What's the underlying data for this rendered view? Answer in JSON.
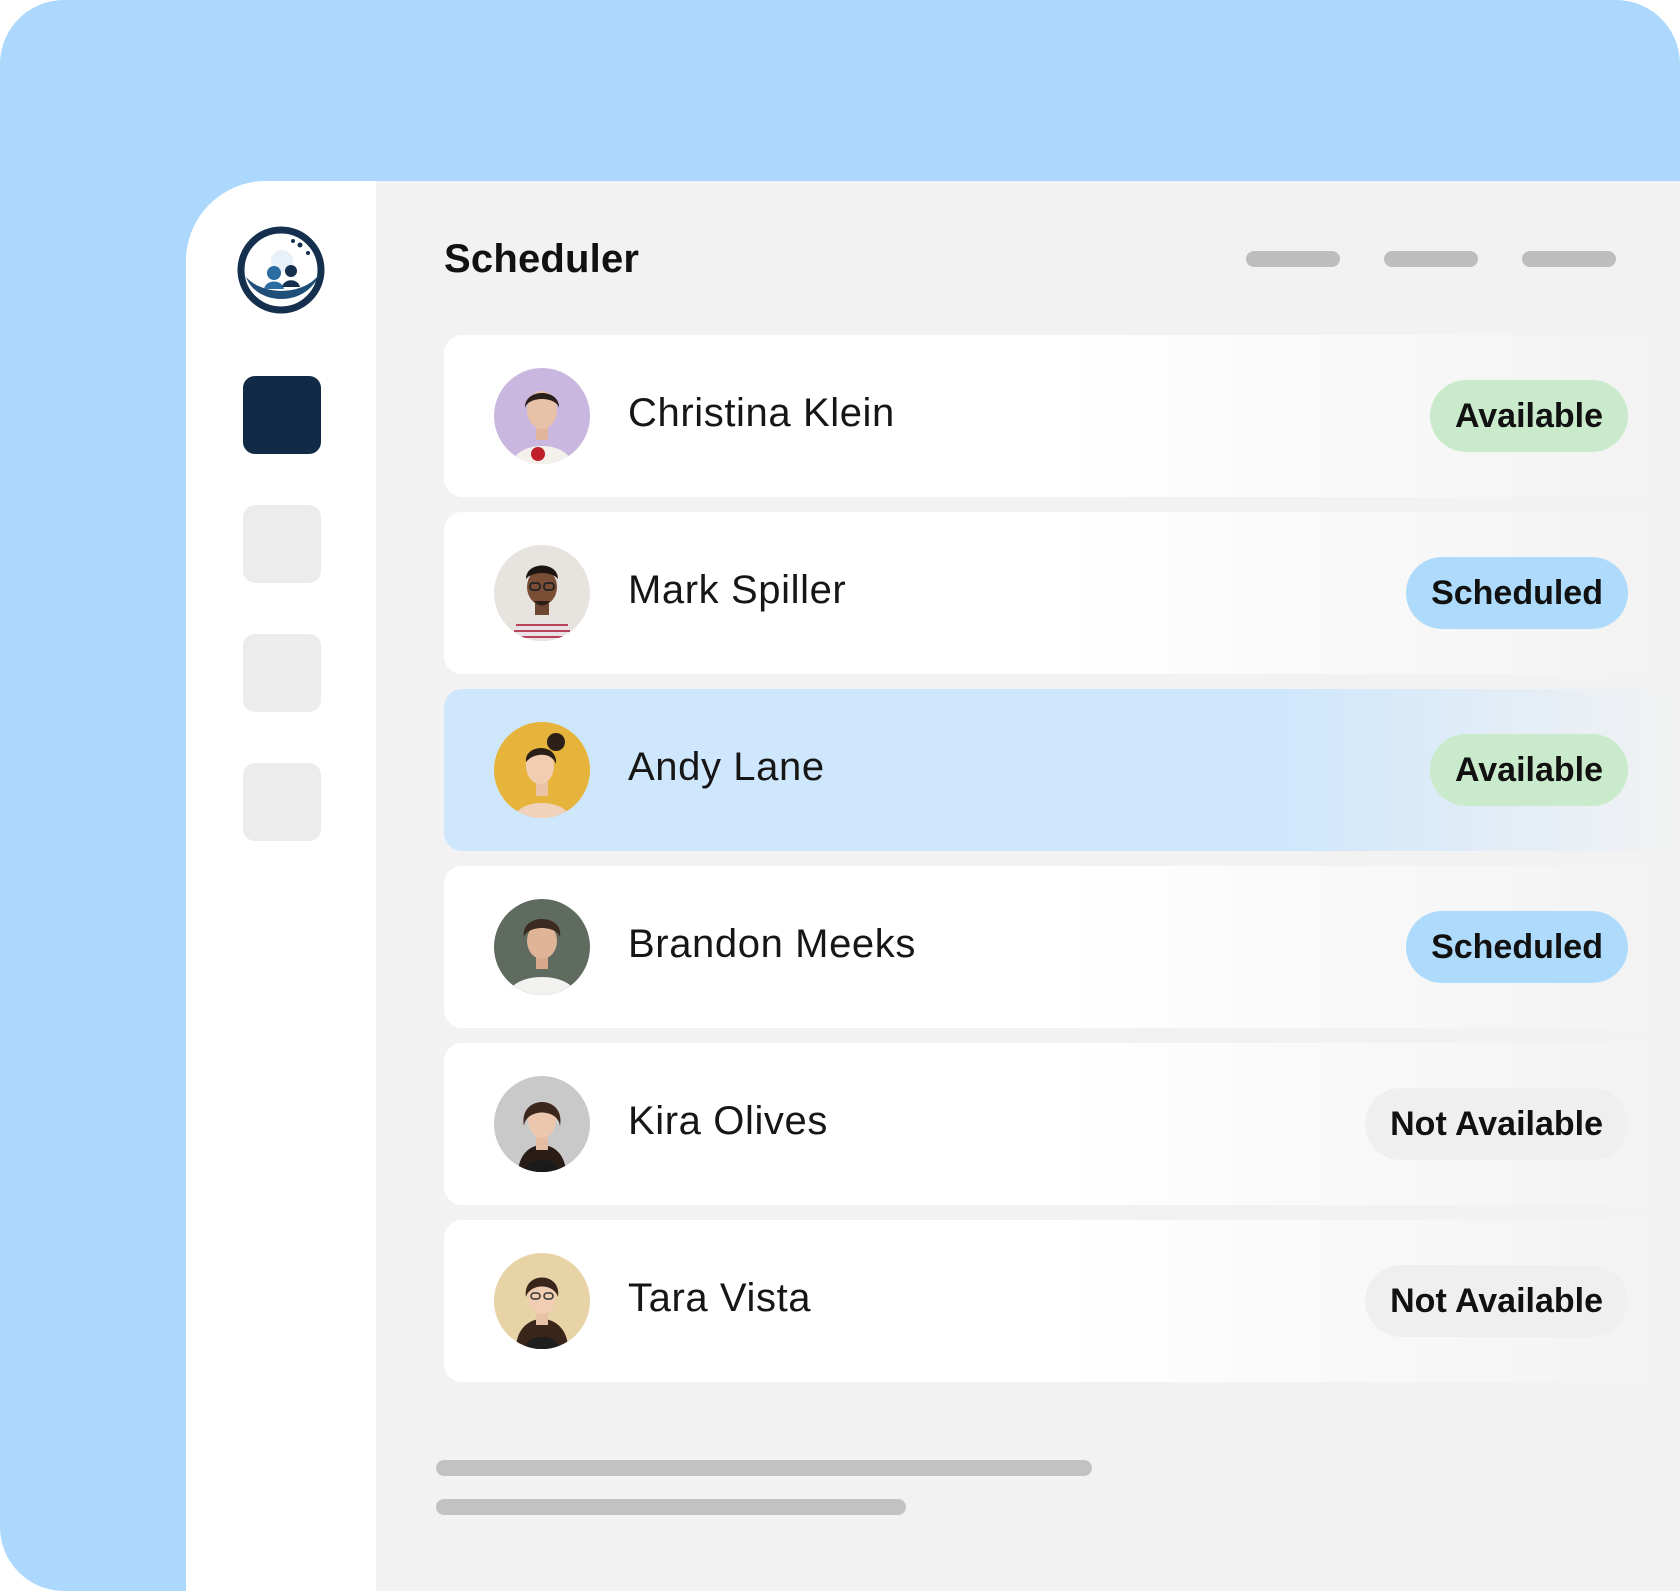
{
  "app": {
    "title": "Scheduler"
  },
  "colors": {
    "frame_background": "#ABD8FC",
    "sidebar_active": "#112A45",
    "available_badge": "#C9EBCB",
    "scheduled_badge": "#AEDBFB",
    "not_available_badge": "#EFEFEF",
    "selected_row": "#CFE7FC"
  },
  "people": [
    {
      "name": "Christina Klein",
      "status": "Available"
    },
    {
      "name": "Mark Spiller",
      "status": "Scheduled"
    },
    {
      "name": "Andy Lane",
      "status": "Available"
    },
    {
      "name": "Brandon Meeks",
      "status": "Scheduled"
    },
    {
      "name": "Kira Olives",
      "status": "Not Available"
    },
    {
      "name": "Tara Vista",
      "status": "Not Available"
    }
  ]
}
